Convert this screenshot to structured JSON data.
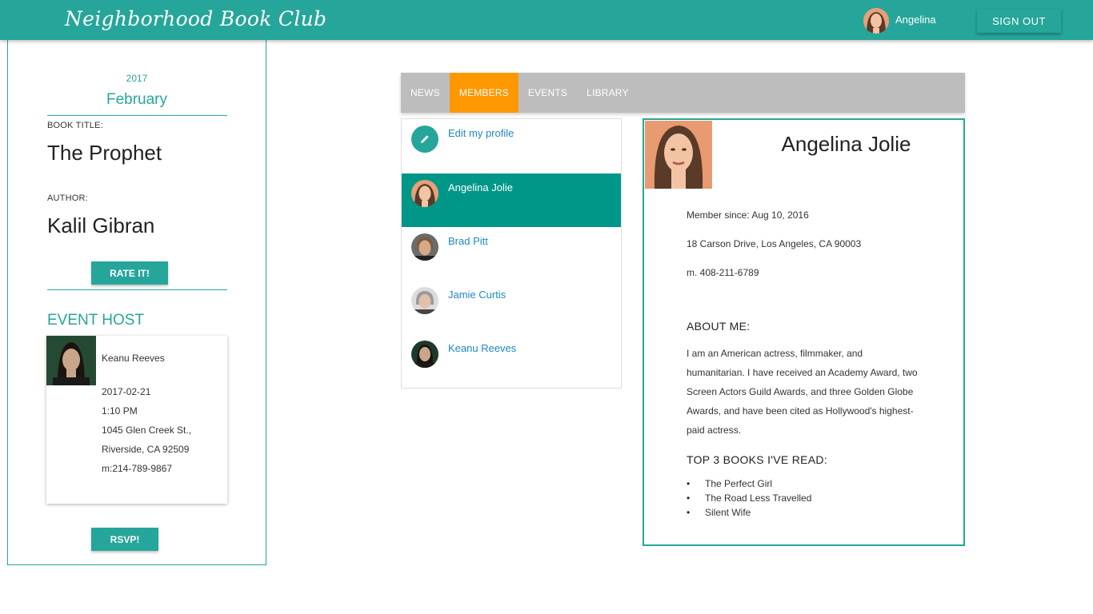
{
  "header": {
    "brand": "Neighborhood Book Club",
    "user_name": "Angelina",
    "signout_label": "SIGN OUT"
  },
  "sidebar": {
    "year": "2017",
    "month": "February",
    "book_title_label": "BOOK TITLE:",
    "book_title": "The Prophet",
    "author_label": "AUTHOR:",
    "author": "Kalil Gibran",
    "rate_label": "RATE IT!",
    "event_host_heading": "EVENT HOST",
    "host": {
      "name": "Keanu Reeves",
      "date": "2017-02-21",
      "time": "1:10 PM",
      "address_line1": "1045 Glen Creek St.,",
      "address_line2": "Riverside, CA 92509",
      "phone": "m:214-789-9867"
    },
    "rsvp_label": "RSVP!"
  },
  "tabs": [
    {
      "label": "NEWS",
      "active": false
    },
    {
      "label": "MEMBERS",
      "active": true
    },
    {
      "label": "EVENTS",
      "active": false
    },
    {
      "label": "LIBRARY",
      "active": false
    }
  ],
  "members": {
    "edit_label": "Edit my profile",
    "list": [
      {
        "name": "Angelina Jolie",
        "active": true
      },
      {
        "name": "Brad Pitt",
        "active": false
      },
      {
        "name": "Jamie Curtis",
        "active": false
      },
      {
        "name": "Keanu Reeves",
        "active": false
      }
    ]
  },
  "profile": {
    "name": "Angelina Jolie",
    "member_since": "Member since: Aug 10, 2016",
    "address": "18 Carson Drive, Los Angeles, CA 90003",
    "phone": "m. 408-211-6789",
    "about_heading": "ABOUT ME:",
    "about_text": "I am an American actress, filmmaker, and humanitarian. I have received an Academy Award, two Screen Actors Guild Awards, and three Golden Globe Awards, and have been cited as Hollywood's highest-paid actress.",
    "books_heading": "TOP 3 BOOKS I'VE READ:",
    "books": [
      "The Perfect Girl",
      "The Road Less Travelled",
      "Silent Wife"
    ]
  },
  "colors": {
    "primary": "#26a69a",
    "active_member": "#009688",
    "active_tab": "#ff9800",
    "tab_bar": "#bdbdbd",
    "link": "#1e88c7"
  }
}
